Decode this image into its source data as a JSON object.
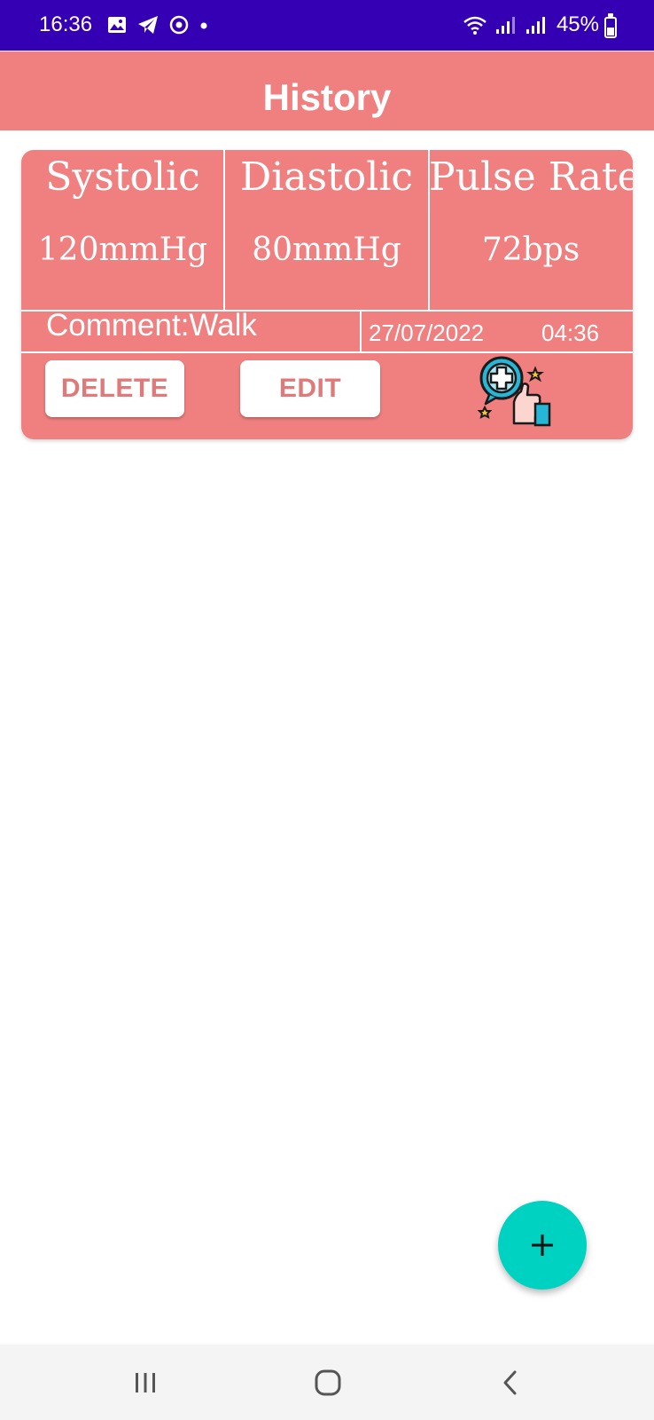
{
  "status_bar": {
    "time": "16:36",
    "battery": "45%",
    "icons": [
      "gallery-icon",
      "telegram-icon",
      "sync-icon",
      "dot-icon",
      "wifi-icon",
      "signal-icon",
      "signal-icon",
      "battery-icon"
    ]
  },
  "app_bar": {
    "title": "History"
  },
  "record": {
    "systolic_label": "Systolic",
    "systolic_value": "120mmHg",
    "diastolic_label": "Diastolic",
    "diastolic_value": "80mmHg",
    "pulse_label": "Pulse Rate",
    "pulse_value": "72bps",
    "comment": "Comment:Walk",
    "date": "27/07/2022",
    "time": "04:36",
    "delete_label": "DELETE",
    "edit_label": "EDIT",
    "status_icon": "health-thumbs-up-icon"
  },
  "fab": {
    "icon": "plus-icon",
    "color": "#00d2c1"
  },
  "nav_bar": {
    "icons": [
      "recents-icon",
      "home-icon",
      "back-icon"
    ]
  },
  "colors": {
    "status_bar": "#3500b3",
    "accent": "#f08080",
    "button_text": "#e07a7a",
    "fab": "#00d2c1"
  }
}
